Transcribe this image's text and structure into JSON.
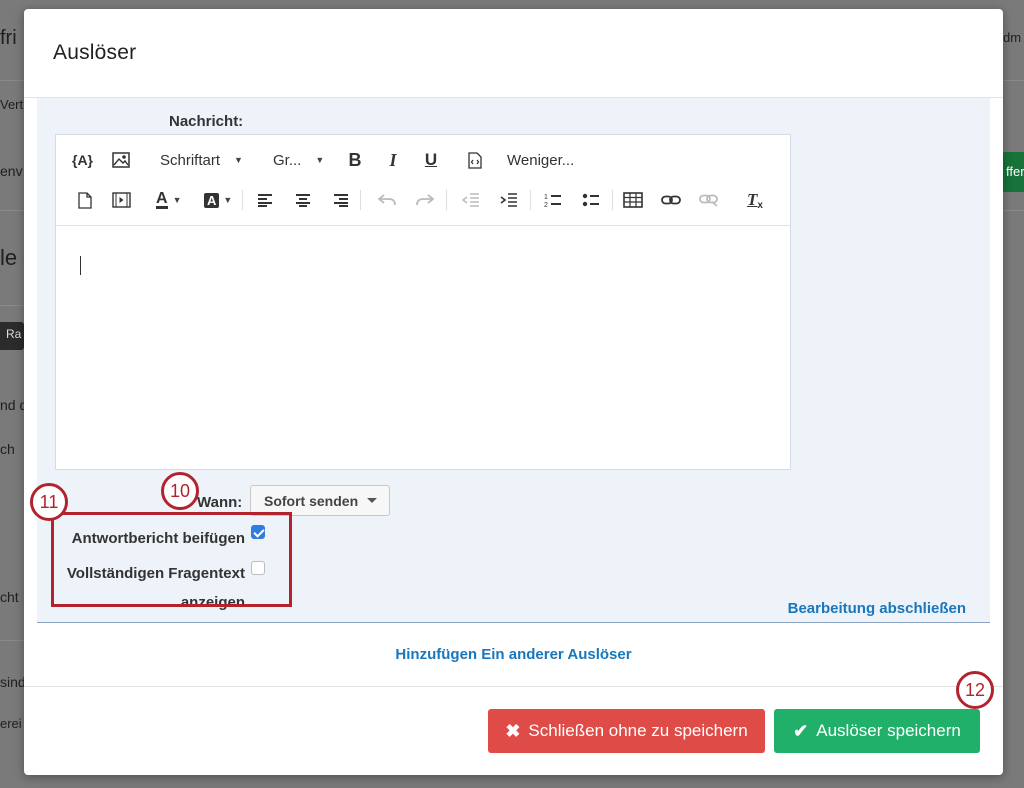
{
  "background": {
    "fragments": [
      "fri",
      "Vert",
      "env",
      "le",
      "Ra",
      "nd d",
      "ch",
      "cht",
      "sind",
      "erei",
      "dm",
      "ffer"
    ]
  },
  "modal": {
    "title": "Auslöser",
    "message_label": "Nachricht:",
    "toolbar": {
      "row1": {
        "piped_text_icon": "{A}",
        "image_icon": "image-icon",
        "font_dropdown_label": "Schriftart",
        "size_dropdown_label": "Gr...",
        "bold_icon": "B",
        "italic_icon": "I",
        "underline_icon": "U",
        "source_icon": "source-code-icon",
        "less_label": "Weniger..."
      },
      "row2": {
        "icons": [
          "document-icon",
          "media-icon",
          "text-color-icon",
          "background-color-icon",
          "align-left-icon",
          "align-center-icon",
          "align-right-icon",
          "undo-icon",
          "redo-icon",
          "outdent-icon",
          "indent-icon",
          "numbered-list-icon",
          "bulleted-list-icon",
          "table-icon",
          "link-icon",
          "unlink-icon",
          "clear-format-icon"
        ]
      }
    },
    "when_label": "Wann:",
    "when_value": "Sofort senden",
    "option1_label": "Antwortbericht beifügen",
    "option1_checked": true,
    "option2_label_line1": "Vollständigen Fragentext",
    "option2_label_line2": "anzeigen",
    "option2_checked": false,
    "finish_link": "Bearbeitung abschließen",
    "add_link": "Hinzufügen Ein anderer Auslöser",
    "cancel_button": "Schließen ohne zu speichern",
    "save_button": "Auslöser speichern",
    "colors": {
      "link": "#1877bd",
      "danger": "#df4b47",
      "success": "#21b06a",
      "annotation": "#b3232e",
      "checkbox": "#2f7de1"
    }
  },
  "annotations": [
    "10",
    "11",
    "12"
  ]
}
